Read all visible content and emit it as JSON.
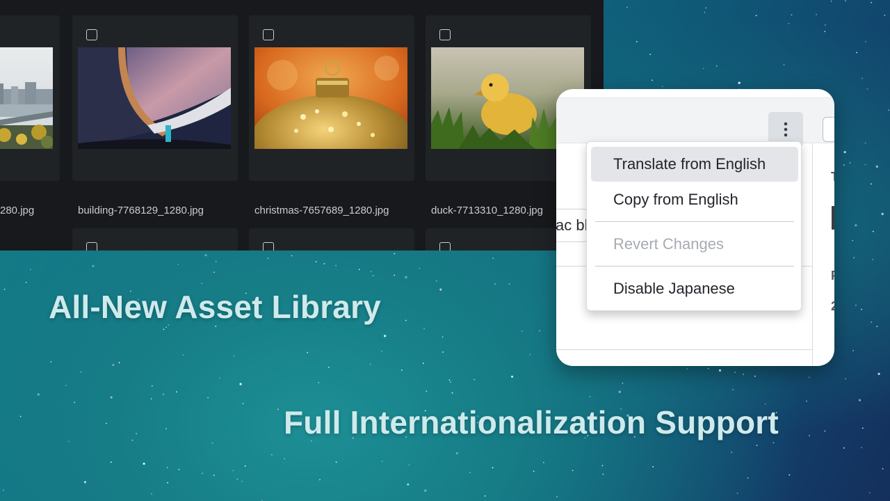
{
  "asset_library": {
    "row1": [
      {
        "filename": "280.jpg"
      },
      {
        "filename": "building-7768129_1280.jpg"
      },
      {
        "filename": "christmas-7657689_1280.jpg"
      },
      {
        "filename": "duck-7713310_1280.jpg"
      }
    ]
  },
  "headlines": {
    "asset_library": "All-New Asset Library",
    "i18n": "Full Internationalization Support"
  },
  "editor": {
    "field_text": "ac bla",
    "side_chars": [
      "T",
      "P",
      "2"
    ],
    "menu": {
      "items": [
        {
          "label": "Translate from English",
          "state": "hovered"
        },
        {
          "label": "Copy from English",
          "state": "normal"
        },
        {
          "label": "Revert Changes",
          "state": "disabled"
        },
        {
          "label": "Disable Japanese",
          "state": "normal"
        }
      ]
    }
  },
  "colors": {
    "headline": "#cfeaec",
    "library_bg": "#17191c",
    "card_bg": "#202326",
    "menu_hover": "#e3e5e8"
  }
}
